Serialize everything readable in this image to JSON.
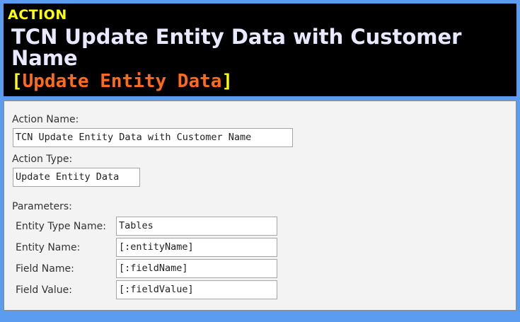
{
  "header": {
    "tag": "ACTION",
    "title": "TCN Update Entity Data with Customer Name",
    "bracket_open": "[",
    "subtitle": "Update Entity Data",
    "bracket_close": "]"
  },
  "form": {
    "action_name_label": "Action Name:",
    "action_name_value": "TCN Update Entity Data with Customer Name",
    "action_type_label": "Action Type:",
    "action_type_value": "Update Entity Data",
    "parameters_label": "Parameters:",
    "parameters": [
      {
        "label": "Entity Type Name:",
        "value": "Tables"
      },
      {
        "label": "Entity Name:",
        "value": "[:entityName]"
      },
      {
        "label": "Field Name:",
        "value": "[:fieldName]"
      },
      {
        "label": "Field Value:",
        "value": "[:fieldValue]"
      }
    ]
  },
  "colors": {
    "background": "#5b9bf0",
    "header_bg": "#000000",
    "tag": "#ffff00",
    "title": "#e8e8ff",
    "subtitle": "#ff6a1a",
    "bracket": "#ffff00"
  }
}
